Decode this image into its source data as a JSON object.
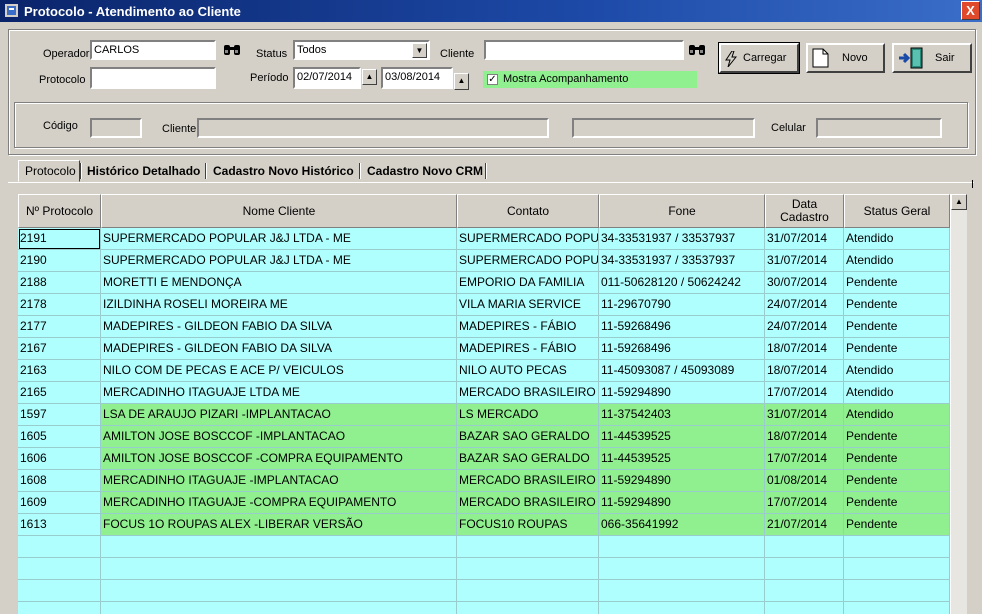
{
  "window": {
    "title": "Protocolo - Atendimento ao Cliente",
    "close": "X"
  },
  "filters": {
    "operador_label": "Operador",
    "operador_value": "CARLOS",
    "protocolo_label": "Protocolo",
    "protocolo_value": "",
    "status_label": "Status",
    "status_value": "Todos",
    "periodo_label": "Período",
    "periodo_from": "02/07/2014",
    "periodo_to": "03/08/2014",
    "cliente_label": "Cliente",
    "cliente_value": "",
    "mostra_label": "Mostra Acompanhamento",
    "mostra_checked": true
  },
  "buttons": {
    "carregar": "Carregar",
    "novo": "Novo",
    "sair": "Sair"
  },
  "client_info": {
    "codigo_label": "Código",
    "cliente_label": "Cliente",
    "celular_label": "Celular"
  },
  "tabs": [
    "Protocolo",
    "Histórico Detalhado",
    "Cadastro Novo Histórico",
    "Cadastro Novo CRM"
  ],
  "grid": {
    "columns": [
      "Nº Protocolo",
      "Nome Cliente",
      "Contato",
      "Fone",
      "Data Cadastro",
      "Status Geral"
    ],
    "rows": [
      {
        "id": "2191",
        "nome": "SUPERMERCADO POPULAR J&J LTDA - ME",
        "contato": "SUPERMERCADO POPULAR",
        "fone": "34-33531937 / 33537937",
        "data": "31/07/2014",
        "status": "Atendido",
        "green": false
      },
      {
        "id": "2190",
        "nome": "SUPERMERCADO POPULAR J&J LTDA - ME",
        "contato": "SUPERMERCADO POPULAR",
        "fone": "34-33531937 / 33537937",
        "data": "31/07/2014",
        "status": "Atendido",
        "green": false
      },
      {
        "id": "2188",
        "nome": "MORETTI E MENDONÇA",
        "contato": "EMPORIO DA FAMILIA",
        "fone": "011-50628120 / 50624242",
        "data": "30/07/2014",
        "status": "Pendente",
        "green": false
      },
      {
        "id": "2178",
        "nome": "IZILDINHA ROSELI MOREIRA ME",
        "contato": "VILA MARIA SERVICE",
        "fone": "11-29670790",
        "data": "24/07/2014",
        "status": "Pendente",
        "green": false
      },
      {
        "id": "2177",
        "nome": "MADEPIRES - GILDEON FABIO DA SILVA",
        "contato": "MADEPIRES - FÁBIO",
        "fone": "11-59268496",
        "data": "24/07/2014",
        "status": "Pendente",
        "green": false
      },
      {
        "id": "2167",
        "nome": "MADEPIRES - GILDEON FABIO DA SILVA",
        "contato": "MADEPIRES - FÁBIO",
        "fone": "11-59268496",
        "data": "18/07/2014",
        "status": "Pendente",
        "green": false
      },
      {
        "id": "2163",
        "nome": "NILO COM DE PECAS E ACE P/ VEICULOS",
        "contato": "NILO AUTO PECAS",
        "fone": "11-45093087 / 45093089",
        "data": "18/07/2014",
        "status": "Atendido",
        "green": false
      },
      {
        "id": "2165",
        "nome": "MERCADINHO ITAGUAJE LTDA ME",
        "contato": "MERCADO BRASILEIRO",
        "fone": "11-59294890",
        "data": "17/07/2014",
        "status": "Atendido",
        "green": false
      },
      {
        "id": "1597",
        "nome": "LSA DE ARAUJO PIZARI -IMPLANTACAO",
        "contato": "LS MERCADO",
        "fone": "11-37542403",
        "data": "31/07/2014",
        "status": "Atendido",
        "green": true
      },
      {
        "id": "1605",
        "nome": "AMILTON JOSE BOSCCOF -IMPLANTACAO",
        "contato": "BAZAR SAO GERALDO",
        "fone": "11-44539525",
        "data": "18/07/2014",
        "status": "Pendente",
        "green": true
      },
      {
        "id": "1606",
        "nome": "AMILTON JOSE BOSCCOF -COMPRA EQUIPAMENTO",
        "contato": "BAZAR SAO GERALDO",
        "fone": "11-44539525",
        "data": "17/07/2014",
        "status": "Pendente",
        "green": true
      },
      {
        "id": "1608",
        "nome": "MERCADINHO ITAGUAJE  -IMPLANTACAO",
        "contato": "MERCADO BRASILEIRO",
        "fone": "11-59294890",
        "data": "01/08/2014",
        "status": "Pendente",
        "green": true
      },
      {
        "id": "1609",
        "nome": "MERCADINHO ITAGUAJE  -COMPRA EQUIPAMENTO",
        "contato": "MERCADO BRASILEIRO",
        "fone": "11-59294890",
        "data": "17/07/2014",
        "status": "Pendente",
        "green": true
      },
      {
        "id": "1613",
        "nome": "FOCUS 1O ROUPAS ALEX -LIBERAR VERSÃO",
        "contato": "FOCUS10 ROUPAS",
        "fone": "066-35641992",
        "data": "21/07/2014",
        "status": "Pendente",
        "green": true
      }
    ]
  },
  "colors": {
    "title_bar": "#0a246a",
    "grid_bg": "#b0ffff",
    "green_row": "#90f090",
    "check_bg": "#90f090"
  }
}
